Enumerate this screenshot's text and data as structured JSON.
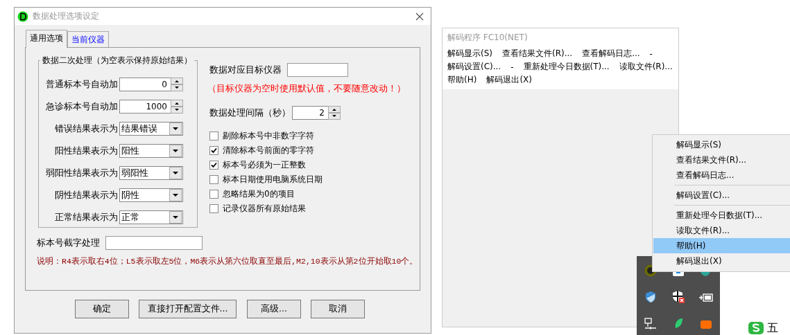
{
  "dialog": {
    "title": "数据处理选项设定",
    "tabs": [
      {
        "label": "通用选项",
        "selected": true
      },
      {
        "label": "当前仪器",
        "selected": false
      }
    ],
    "group": {
      "title": "数据二次处理（为空表示保持原始结果）",
      "fields": [
        {
          "kind": "spin",
          "label": "普通标本号自动加",
          "value": "0"
        },
        {
          "kind": "spin",
          "label": "急诊标本号自动加",
          "value": "1000"
        },
        {
          "kind": "combo",
          "label": "错误结果表示为",
          "value": "结果错误"
        },
        {
          "kind": "combo",
          "label": "阳性结果表示为",
          "value": "阳性"
        },
        {
          "kind": "combo",
          "label": "弱阳性结果表示为",
          "value": "弱阳性"
        },
        {
          "kind": "combo",
          "label": "阴性结果表示为",
          "value": "阴性"
        },
        {
          "kind": "combo",
          "label": "正常结果表示为",
          "value": "正常"
        }
      ]
    },
    "target": {
      "label": "数据对应目标仪器"
    },
    "warning": "（目标仪器为空时使用默认值，不要随意改动！）",
    "interval": {
      "label": "数据处理间隔（秒）",
      "value": "2"
    },
    "checkboxes": [
      {
        "label": "剔除标本号中非数字字符",
        "checked": false
      },
      {
        "label": "清除标本号前面的零字符",
        "checked": true
      },
      {
        "label": "标本号必须为一正整数",
        "checked": true
      },
      {
        "label": "标本日期使用电脑系统日期",
        "checked": false
      },
      {
        "label": "忽略结果为0的项目",
        "checked": false
      },
      {
        "label": "记录仪器所有原始结果",
        "checked": false
      }
    ],
    "truncate": {
      "label": "标本号截字处理"
    },
    "note": "说明：R4表示取右4位；L5表示取左5位，M6表示从第六位取直至最后,M2,10表示从第2位开始取10个。",
    "buttons": [
      "确定",
      "直接打开配置文件...",
      "高级...",
      "取消"
    ]
  },
  "decoder_window": {
    "title": "解码程序 FC10(NET)",
    "menu_lines": [
      [
        "解码显示(S)",
        "查看结果文件(R)...",
        "查看解码日志...",
        "-"
      ],
      [
        "解码设置(C)...",
        "-",
        "重新处理今日数据(T)...",
        "读取文件(R)..."
      ],
      [
        "帮助(H)",
        "解码退出(X)"
      ]
    ]
  },
  "context_menu": {
    "items": [
      {
        "kind": "item",
        "label": "解码显示(S)",
        "selected": false
      },
      {
        "kind": "item",
        "label": "查看结果文件(R)...",
        "selected": false
      },
      {
        "kind": "item",
        "label": "查看解码日志...",
        "selected": false
      },
      {
        "kind": "separator"
      },
      {
        "kind": "item",
        "label": "解码设置(C)...",
        "selected": false
      },
      {
        "kind": "separator"
      },
      {
        "kind": "item",
        "label": "重新处理今日数据(T)...",
        "selected": false
      },
      {
        "kind": "item",
        "label": "读取文件(R)...",
        "selected": false
      },
      {
        "kind": "item",
        "label": "帮助(H)",
        "selected": true
      },
      {
        "kind": "item",
        "label": "解码退出(X)",
        "selected": false
      }
    ]
  },
  "ime": {
    "mode": "五"
  }
}
